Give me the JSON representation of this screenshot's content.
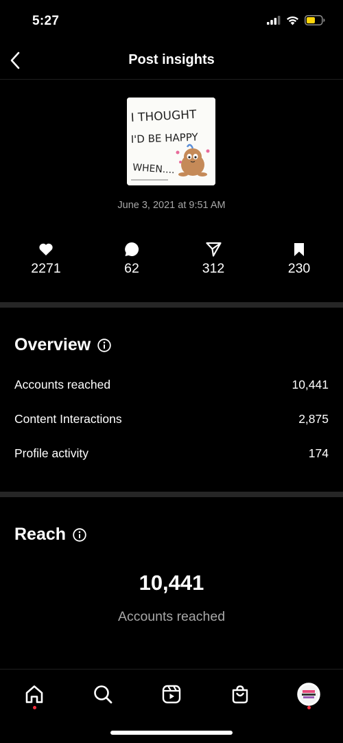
{
  "status_bar": {
    "time": "5:27",
    "battery_color": "#ffd60a"
  },
  "header": {
    "title": "Post insights",
    "back_icon": "chevron-left-icon"
  },
  "post": {
    "thumbnail_text_line1": "I THOUGHT",
    "thumbnail_text_line2": "I'D BE HAPPY",
    "thumbnail_text_line3": "WHEN....",
    "date": "June 3, 2021 at 9:51 AM"
  },
  "stats": [
    {
      "icon": "heart-icon",
      "value": "2271"
    },
    {
      "icon": "comment-icon",
      "value": "62"
    },
    {
      "icon": "share-icon",
      "value": "312"
    },
    {
      "icon": "bookmark-icon",
      "value": "230"
    }
  ],
  "overview": {
    "title": "Overview",
    "rows": [
      {
        "label": "Accounts reached",
        "value": "10,441"
      },
      {
        "label": "Content Interactions",
        "value": "2,875"
      },
      {
        "label": "Profile activity",
        "value": "174"
      }
    ]
  },
  "reach": {
    "title": "Reach",
    "number": "10,441",
    "label": "Accounts reached"
  },
  "tabbar": {
    "items": [
      "home-icon",
      "search-icon",
      "reels-icon",
      "shop-icon",
      "profile-avatar"
    ],
    "notification_dot_color": "#ff3040"
  }
}
